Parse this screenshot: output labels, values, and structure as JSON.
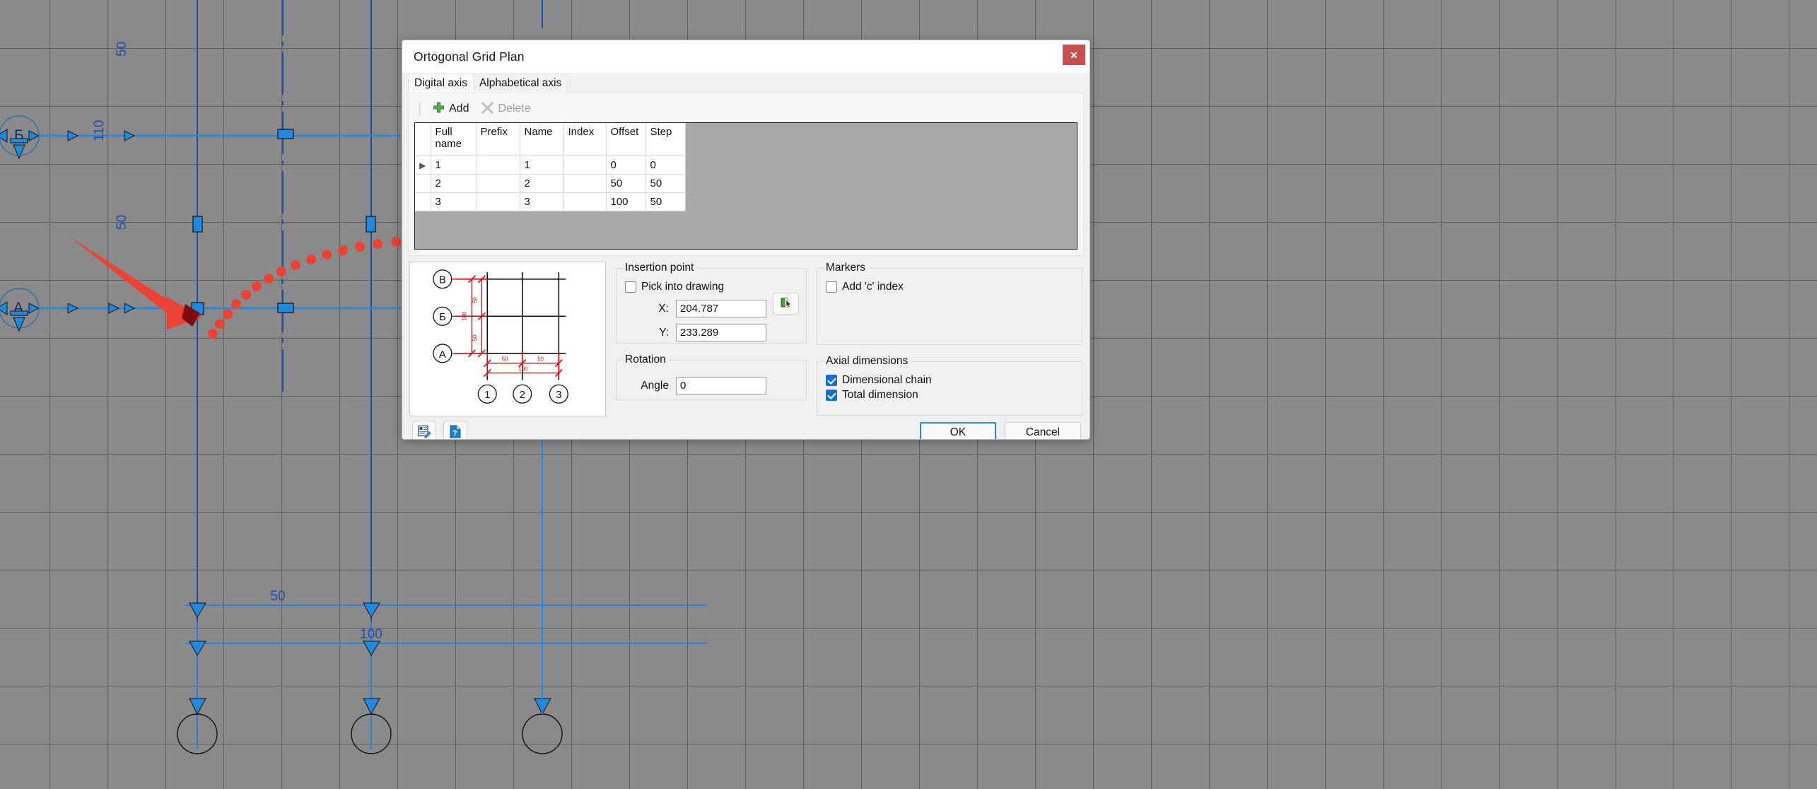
{
  "dialog": {
    "title": "Ortogonal Grid Plan",
    "close_label": "✕",
    "close_icon": "close-icon",
    "tabs": [
      {
        "label": "Digital axis",
        "active": true
      },
      {
        "label": "Alphabetical axis",
        "active": false
      }
    ],
    "toolbar": {
      "add_label": "Add",
      "add_icon": "plus-icon",
      "delete_label": "Delete",
      "delete_icon": "x-icon",
      "delete_disabled": true
    },
    "table": {
      "columns": [
        "Full name",
        "Prefix",
        "Name",
        "Index",
        "Offset",
        "Step"
      ],
      "rows": [
        {
          "selected": true,
          "marker": "▶",
          "full_name": "1",
          "prefix": "",
          "name": "1",
          "index": "",
          "offset": "0",
          "step": "0"
        },
        {
          "selected": false,
          "marker": "",
          "full_name": "2",
          "prefix": "",
          "name": "2",
          "index": "",
          "offset": "50",
          "step": "50"
        },
        {
          "selected": false,
          "marker": "",
          "full_name": "3",
          "prefix": "",
          "name": "3",
          "index": "",
          "offset": "100",
          "step": "50"
        }
      ]
    },
    "insertion_point": {
      "legend": "Insertion point",
      "pick_label": "Pick into drawing",
      "pick_checked": false,
      "pick_button_icon": "pick-point-icon",
      "x_label": "X:",
      "x_value": "204.787",
      "y_label": "Y:",
      "y_value": "233.289"
    },
    "rotation": {
      "legend": "Rotation",
      "angle_label": "Angle",
      "angle_value": "0"
    },
    "markers": {
      "legend": "Markers",
      "add_c_index_label": "Add 'c' index",
      "add_c_index_checked": false
    },
    "axial_dimensions": {
      "legend": "Axial dimensions",
      "dimensional_chain_label": "Dimensional chain",
      "dimensional_chain_checked": true,
      "total_dimension_label": "Total dimension",
      "total_dimension_checked": true
    },
    "footer": {
      "settings_icon": "edit-list-icon",
      "help_icon": "help-document-icon",
      "ok_label": "OK",
      "cancel_label": "Cancel"
    },
    "preview": {
      "row_labels": [
        "В",
        "Б",
        "А"
      ],
      "col_labels": [
        "1",
        "2",
        "3"
      ],
      "vertical_dims": [
        "50",
        "50"
      ],
      "vertical_total": "100",
      "horizontal_dims": [
        "50",
        "50"
      ],
      "horizontal_total": "100"
    }
  },
  "drawing": {
    "axis_bubbles_left": [
      "Б",
      "А"
    ],
    "dimension_labels": {
      "vertical_top": "50",
      "vertical_left": "110",
      "vertical_mid": "50",
      "horizontal_chain": "50",
      "horizontal_total": "100"
    }
  },
  "colors": {
    "accent": "#0a77cb",
    "close": "#c5504f",
    "annotation": "#ec4233",
    "cad_line": "#1f5fd0",
    "cad_bg": "#8a8a8a"
  }
}
